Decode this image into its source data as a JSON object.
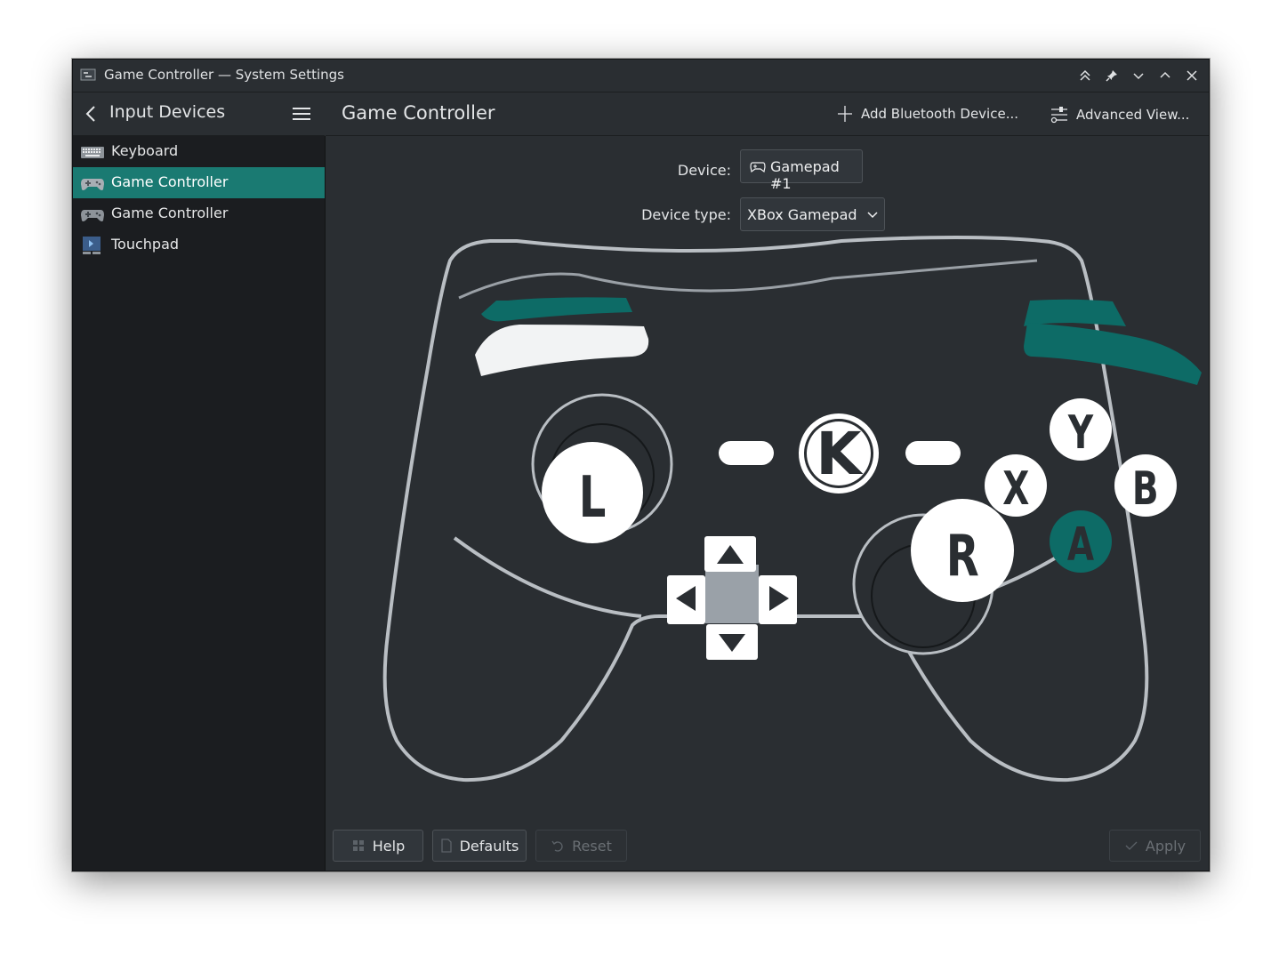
{
  "window": {
    "title": "Game Controller — System Settings",
    "controls": [
      "keep-above-icon",
      "pin-icon",
      "minimize-icon",
      "maximize-icon",
      "close-icon"
    ]
  },
  "sidebar": {
    "back_label": "Input Devices",
    "items": [
      {
        "label": "Keyboard",
        "icon": "keyboard-icon",
        "active": false
      },
      {
        "label": "Game Controller",
        "icon": "gamepad-icon",
        "active": true
      },
      {
        "label": "Game Controller",
        "icon": "gamepad-icon",
        "active": false
      },
      {
        "label": "Touchpad",
        "icon": "touchpad-icon",
        "active": false
      }
    ]
  },
  "main": {
    "title": "Game Controller",
    "add_bluetooth_label": "Add Bluetooth Device...",
    "advanced_view_label": "Advanced View...",
    "device_label": "Device:",
    "device_value": "Gamepad #1",
    "device_type_label": "Device type:",
    "device_type_value": "XBox Gamepad"
  },
  "controller": {
    "left_stick_label": "L",
    "right_stick_label": "R",
    "buttons": {
      "y": "Y",
      "x": "X",
      "b": "B",
      "a": "A"
    },
    "active_button": "A",
    "home_logo": "K"
  },
  "footer": {
    "help_label": "Help",
    "defaults_label": "Defaults",
    "reset_label": "Reset",
    "apply_label": "Apply"
  },
  "colors": {
    "accent": "#1a7a72",
    "teal_highlight": "#0d6b66",
    "background": "#2a2e32",
    "sidebar_bg": "#1b1d20",
    "outline": "#b9bec3"
  }
}
